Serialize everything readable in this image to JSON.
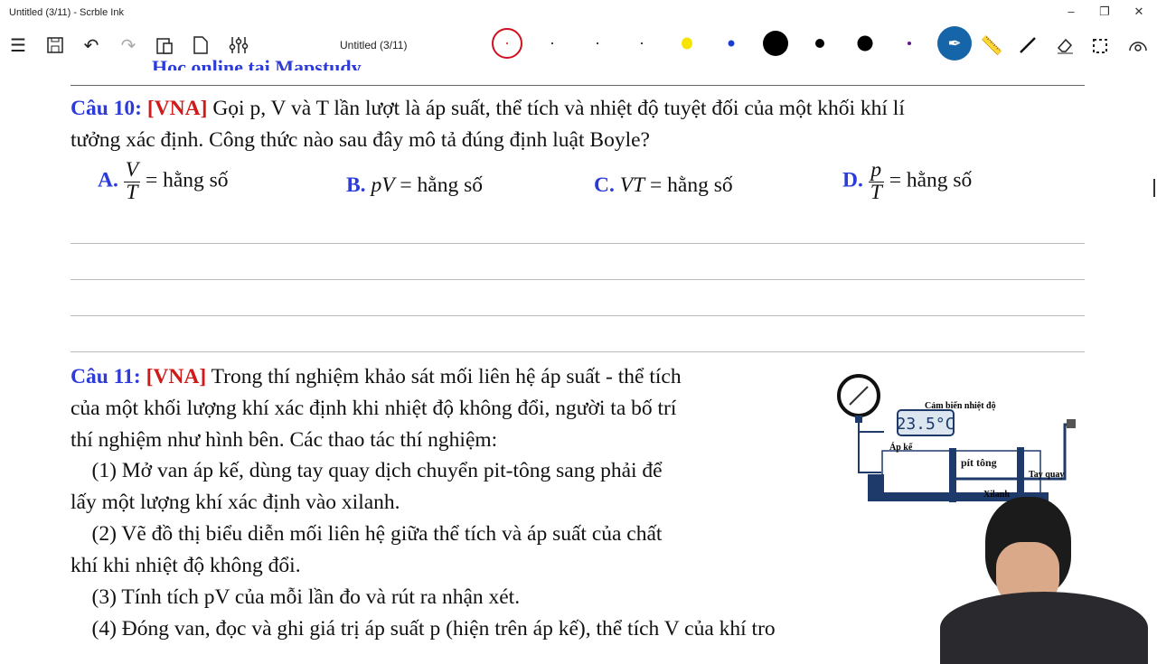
{
  "window": {
    "title": "Untitled (3/11) - Scrble Ink",
    "doc_title": "Untitled (3/11)"
  },
  "toolbar": {
    "icons": [
      "menu-icon",
      "save-icon",
      "undo-icon",
      "redo-icon",
      "paste-icon",
      "new-page-icon",
      "settings-sliders-icon"
    ],
    "pens": [
      {
        "color": "#000000",
        "selected": true
      },
      {
        "color": "#333333"
      },
      {
        "color": "#333333"
      },
      {
        "color": "#333333"
      },
      {
        "color": "#f5e400"
      },
      {
        "color": "#1a3fd0"
      },
      {
        "color": "#000000"
      },
      {
        "color": "#000000"
      },
      {
        "color": "#000000"
      },
      {
        "color": "#5a1a8a"
      }
    ],
    "tools": [
      "pen-icon",
      "ruler-icon",
      "line-icon",
      "eraser-icon",
      "select-icon",
      "touch-icon"
    ],
    "accent": "#1565a8"
  },
  "header_banner": "Học online tại Mapstudy",
  "q10": {
    "label": "Câu 10:",
    "tag": "[VNA]",
    "line1": " Gọi p, V và T lần lượt là áp suất, thể tích và nhiệt độ tuyệt đối của một khối khí lí",
    "line2": "tưởng xác định. Công thức nào sau đây mô tả đúng định luật Boyle?",
    "options": [
      {
        "letter": "A.",
        "num": "V",
        "den": "T",
        "rest": "= hằng số"
      },
      {
        "letter": "B.",
        "expr": "pV",
        "rest": " = hằng số"
      },
      {
        "letter": "C.",
        "expr": "VT",
        "rest": " = hằng số"
      },
      {
        "letter": "D.",
        "num": "p",
        "den": "T",
        "rest": "= hằng số"
      }
    ]
  },
  "q11": {
    "label": "Câu 11:",
    "tag": "[VNA]",
    "lines": [
      " Trong thí nghiệm khảo sát mối liên hệ áp suất - thể tích",
      "của một khối lượng khí xác định khi nhiệt độ không đổi, người ta bố trí",
      "thí nghiệm như hình bên. Các thao tác thí nghiệm:",
      "    (1) Mở van áp kế, dùng tay quay dịch chuyển pit-tông sang phải để",
      "lấy một lượng khí xác định vào xilanh.",
      "    (2) Vẽ đồ thị biểu diễn mối liên hệ giữa thể tích và áp suất của chất",
      "khí khi nhiệt độ không đổi.",
      "    (3) Tính tích pV của mỗi lần đo và rút ra nhận xét.",
      "    (4) Đóng van, đọc và ghi giá trị áp suất p (hiện trên áp kế), thể tích V của khí tro"
    ],
    "figure": {
      "gauge": "Áp kế",
      "sensor": "Cảm biến nhiệt độ",
      "temp": "23.5°C",
      "handle": "Tay quay",
      "cylinder": "Xilanh",
      "piston": "pít tông"
    }
  }
}
